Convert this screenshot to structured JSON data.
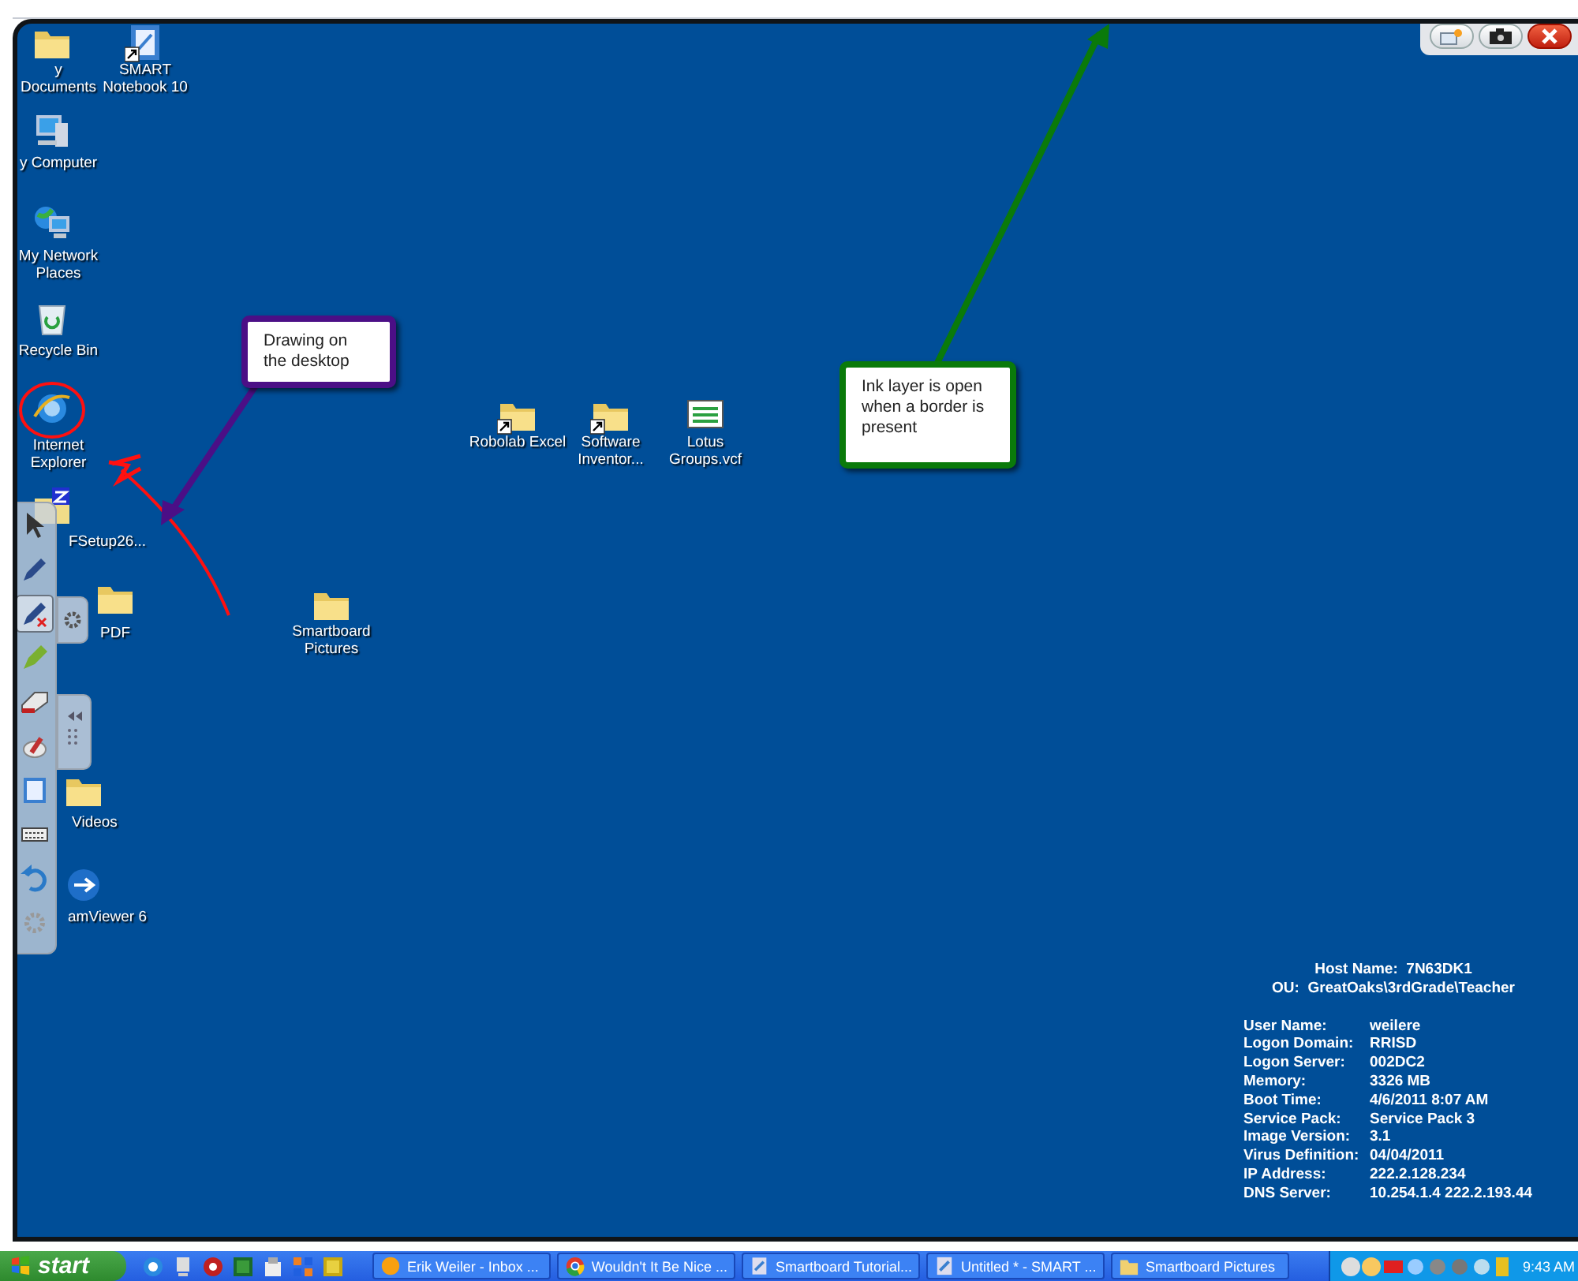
{
  "desktop_icons": [
    {
      "kind": "documents",
      "label": "y Documents",
      "shortcut": false
    },
    {
      "kind": "notebook",
      "label": "SMART Notebook 10",
      "shortcut": true
    },
    {
      "kind": "computer",
      "label": "y Computer",
      "shortcut": false
    },
    {
      "kind": "network",
      "label": "My Network Places",
      "shortcut": false
    },
    {
      "kind": "recycle",
      "label": "Recycle Bin",
      "shortcut": false
    },
    {
      "kind": "browser",
      "label": "Internet Explorer",
      "shortcut": false
    },
    {
      "kind": "zip",
      "label": "FSetup26...",
      "shortcut": false
    },
    {
      "kind": "folder",
      "label": "PDF",
      "shortcut": false
    },
    {
      "kind": "folder",
      "label": "Videos",
      "shortcut": false
    },
    {
      "kind": "app",
      "label": "amViewer 6",
      "shortcut": false
    },
    {
      "kind": "folder",
      "label": "Robolab Excel",
      "shortcut": true
    },
    {
      "kind": "folder",
      "label": "Software Inventor...",
      "shortcut": true
    },
    {
      "kind": "card",
      "label": "Lotus Groups.vcf",
      "shortcut": false
    },
    {
      "kind": "folder",
      "label": "Smartboard Pictures",
      "shortcut": false
    }
  ],
  "callouts": [
    {
      "text": "Drawing on the desktop",
      "color": "#4b0f86"
    },
    {
      "text": "Ink layer is open when a border is present",
      "color": "#0a7a0a"
    }
  ],
  "ink_toolbar": {
    "tools": [
      {
        "kind": "pointer",
        "selected": false
      },
      {
        "kind": "pen",
        "selected": false
      },
      {
        "kind": "pen-erase",
        "selected": true
      },
      {
        "kind": "highlighter",
        "selected": false
      },
      {
        "kind": "eraser",
        "selected": false
      },
      {
        "kind": "magic-pen",
        "selected": false
      },
      {
        "kind": "notebook",
        "selected": false
      },
      {
        "kind": "keyboard",
        "selected": false
      },
      {
        "kind": "undo",
        "selected": false
      },
      {
        "kind": "settings",
        "selected": false
      }
    ]
  },
  "system_info": {
    "host": {
      "label": "Host Name:",
      "value": "7N63DK1"
    },
    "ou": {
      "label": "OU:",
      "value": "GreatOaks\\3rdGrade\\Teacher"
    },
    "rows": [
      {
        "label": "User Name:",
        "value": "weilere"
      },
      {
        "label": "Logon Domain:",
        "value": "RRISD"
      },
      {
        "label": "Logon Server:",
        "value": "002DC2"
      },
      {
        "label": "Memory:",
        "value": "3326 MB"
      },
      {
        "label": "Boot Time:",
        "value": "4/6/2011 8:07 AM"
      },
      {
        "label": "Service Pack:",
        "value": "Service Pack 3"
      },
      {
        "label": "Image Version:",
        "value": "3.1"
      },
      {
        "label": "Virus Definition:",
        "value": "04/04/2011"
      },
      {
        "label": "IP Address:",
        "value": "222.2.128.234"
      },
      {
        "label": "DNS Server:",
        "value": "10.254.1.4 222.2.193.44"
      }
    ]
  },
  "taskbar": {
    "start": "start",
    "tasks": [
      {
        "label": "Erik Weiler - Inbox ...",
        "kind": "mail",
        "selected": false
      },
      {
        "label": "Wouldn't It Be Nice ...",
        "kind": "chrome",
        "selected": false
      },
      {
        "label": "Smartboard Tutorial...",
        "kind": "notebook",
        "selected": false
      },
      {
        "label": "Untitled * - SMART ...",
        "kind": "notebook",
        "selected": false
      },
      {
        "label": "Smartboard Pictures",
        "kind": "folder",
        "selected": false
      }
    ],
    "clock": "9:43 AM"
  }
}
